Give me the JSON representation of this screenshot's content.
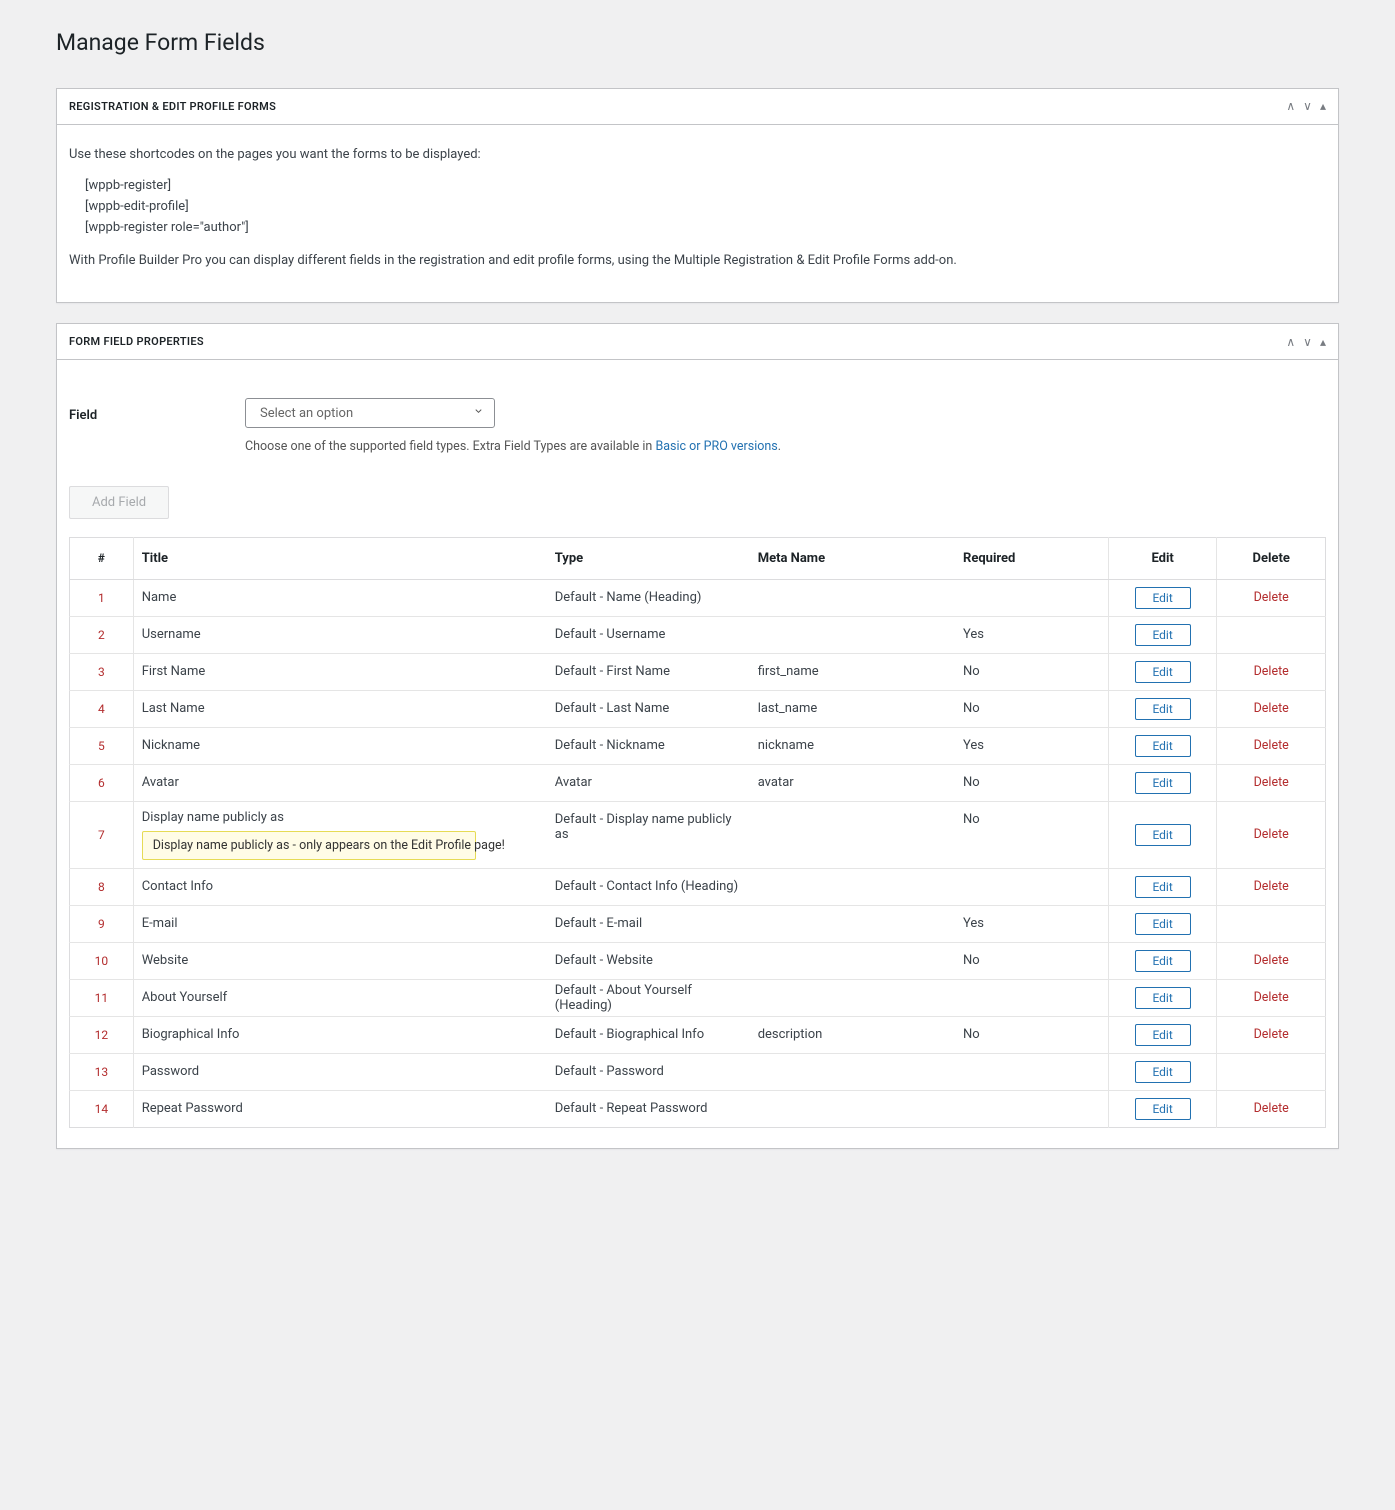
{
  "page": {
    "title": "Manage Form Fields"
  },
  "panel1": {
    "heading": "REGISTRATION & EDIT PROFILE FORMS",
    "intro": "Use these shortcodes on the pages you want the forms to be displayed:",
    "shortcodes": [
      "[wppb-register]",
      "[wppb-edit-profile]",
      "[wppb-register role=\"author\"]"
    ],
    "footer": "With Profile Builder Pro you can display different fields in the registration and edit profile forms, using the Multiple Registration & Edit Profile Forms add-on."
  },
  "panel2": {
    "heading": "FORM FIELD PROPERTIES",
    "field_label": "Field",
    "select_placeholder": "Select an option",
    "help_text_prefix": "Choose one of the supported field types. Extra Field Types are available in ",
    "help_link": "Basic or PRO versions",
    "help_text_suffix": ".",
    "add_btn": "Add Field"
  },
  "table": {
    "headers": {
      "num": "#",
      "title": "Title",
      "type": "Type",
      "meta": "Meta Name",
      "req": "Required",
      "edit": "Edit",
      "delete": "Delete"
    },
    "edit_label": "Edit",
    "delete_label": "Delete",
    "rows": [
      {
        "num": "1",
        "title": "Name",
        "type": "Default - Name (Heading)",
        "meta": "",
        "req": "",
        "deletable": true,
        "note": ""
      },
      {
        "num": "2",
        "title": "Username",
        "type": "Default - Username",
        "meta": "",
        "req": "Yes",
        "deletable": false,
        "note": ""
      },
      {
        "num": "3",
        "title": "First Name",
        "type": "Default - First Name",
        "meta": "first_name",
        "req": "No",
        "deletable": true,
        "note": ""
      },
      {
        "num": "4",
        "title": "Last Name",
        "type": "Default - Last Name",
        "meta": "last_name",
        "req": "No",
        "deletable": true,
        "note": ""
      },
      {
        "num": "5",
        "title": "Nickname",
        "type": "Default - Nickname",
        "meta": "nickname",
        "req": "Yes",
        "deletable": true,
        "note": ""
      },
      {
        "num": "6",
        "title": "Avatar",
        "type": "Avatar",
        "meta": "avatar",
        "req": "No",
        "deletable": true,
        "note": ""
      },
      {
        "num": "7",
        "title": "Display name publicly as",
        "type": "Default - Display name publicly as",
        "meta": "",
        "req": "No",
        "deletable": true,
        "note": "Display name publicly as - only appears on the Edit Profile page!"
      },
      {
        "num": "8",
        "title": "Contact Info",
        "type": "Default - Contact Info (Heading)",
        "meta": "",
        "req": "",
        "deletable": true,
        "note": ""
      },
      {
        "num": "9",
        "title": "E-mail",
        "type": "Default - E-mail",
        "meta": "",
        "req": "Yes",
        "deletable": false,
        "note": ""
      },
      {
        "num": "10",
        "title": "Website",
        "type": "Default - Website",
        "meta": "",
        "req": "No",
        "deletable": true,
        "note": ""
      },
      {
        "num": "11",
        "title": "About Yourself",
        "type": "Default - About Yourself (Heading)",
        "meta": "",
        "req": "",
        "deletable": true,
        "note": ""
      },
      {
        "num": "12",
        "title": "Biographical Info",
        "type": "Default - Biographical Info",
        "meta": "description",
        "req": "No",
        "deletable": true,
        "note": ""
      },
      {
        "num": "13",
        "title": "Password",
        "type": "Default - Password",
        "meta": "",
        "req": "",
        "deletable": false,
        "note": ""
      },
      {
        "num": "14",
        "title": "Repeat Password",
        "type": "Default - Repeat Password",
        "meta": "",
        "req": "",
        "deletable": true,
        "note": ""
      }
    ]
  }
}
